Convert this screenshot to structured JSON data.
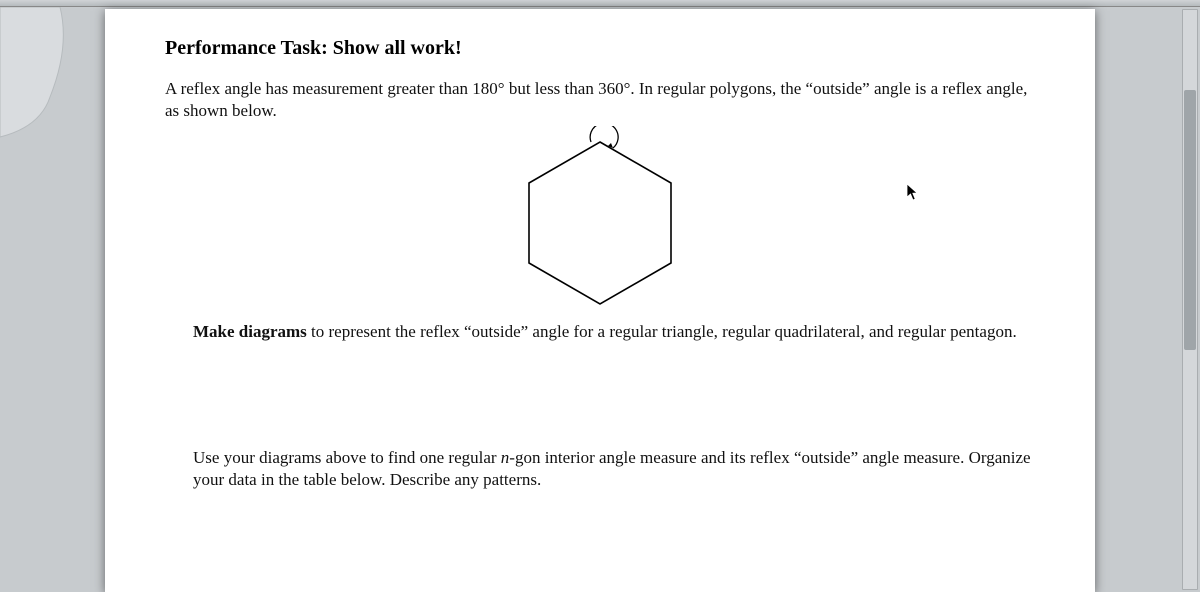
{
  "doc": {
    "title": "Performance Task: Show all work!",
    "intro": "A reflex angle has measurement greater than 180° but less than 360°. In regular polygons, the “outside” angle is a reflex angle, as shown below.",
    "make_lead": "Make diagrams",
    "make_rest": " to represent the reflex “outside” angle for a regular triangle, regular quadrilateral, and regular pentagon.",
    "use_pre": "Use your diagrams above to find one regular ",
    "use_n": "n",
    "use_post": "-gon interior angle measure and its reflex “outside” angle measure.  Organize your data in the table below. Describe any patterns."
  }
}
